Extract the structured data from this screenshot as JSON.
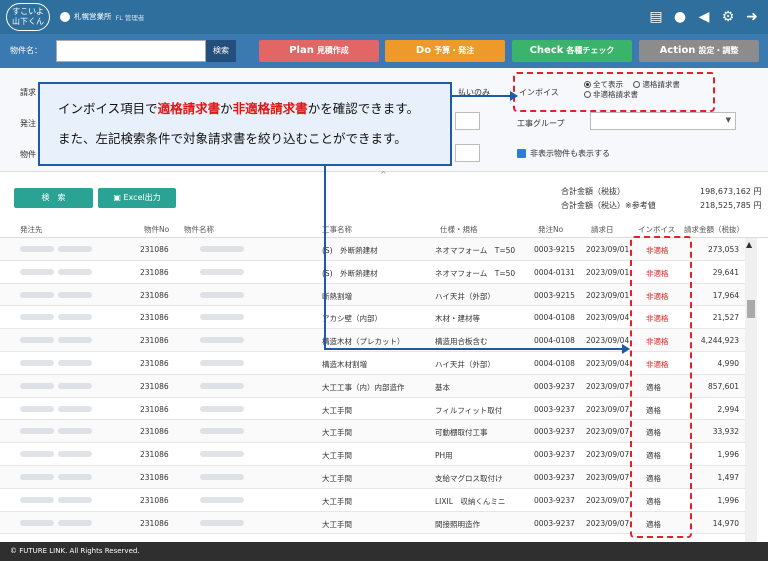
{
  "header": {
    "logo_line1": "すこいよ",
    "logo_line2": "山下くん",
    "office": "札幌営業所",
    "role": "FL 管理者",
    "icons": [
      "document-icon",
      "chat-icon",
      "megaphone-icon",
      "gear-icon",
      "logout-icon"
    ]
  },
  "searchbar": {
    "label": "物件名：",
    "value": "",
    "button": "検索"
  },
  "nav": [
    {
      "big": "Plan",
      "label": "見積作成",
      "color": "#e36666"
    },
    {
      "big": "Do",
      "label": "予算・発注",
      "color": "#ee9a2a"
    },
    {
      "big": "Check",
      "label": "各種チェック",
      "color": "#39b46a"
    },
    {
      "big": "Action",
      "label": "設定・調整",
      "color": "#8c8c8c"
    }
  ],
  "filters": {
    "label_request": "請求",
    "label_order": "発注",
    "label_property": "物件",
    "pay_only": "払いのみ",
    "invoice_label": "インボイス",
    "radio_all": "全て表示",
    "radio_qualified": "適格請求書",
    "radio_unqualified": "非適格請求書",
    "construction_group": "工事グループ",
    "show_hidden": "非表示物件も表示する"
  },
  "actions": {
    "search": "検　索",
    "excel": "Excel出力"
  },
  "totals": {
    "label_ex_tax": "合計金額（税抜）",
    "value_ex_tax": "198,673,162 円",
    "label_in_tax": "合計金額（税込）※参考値",
    "value_in_tax": "218,525,785 円"
  },
  "table": {
    "headers": [
      "発注先",
      "物件No",
      "物件名称",
      "工事名称",
      "仕様・規格",
      "発注No",
      "請求日",
      "インボイス",
      "請求金額（税抜）"
    ],
    "rows": [
      {
        "no": "231086",
        "work": "(S)　外断熱建材",
        "spec": "ネオマフォーム　T=50",
        "order": "0003-9215",
        "date": "2023/09/01",
        "invoice": "非適格",
        "amount": "273,053"
      },
      {
        "no": "231086",
        "work": "(S)　外断熱建材",
        "spec": "ネオマフォーム　T=50",
        "order": "0004-0131",
        "date": "2023/09/01",
        "invoice": "非適格",
        "amount": "29,641"
      },
      {
        "no": "231086",
        "work": "断熱割増",
        "spec": "ハイ天井（外部）",
        "order": "0003-9215",
        "date": "2023/09/01",
        "invoice": "非適格",
        "amount": "17,964"
      },
      {
        "no": "231086",
        "work": "アカシ壁（内部）",
        "spec": "木材・建材等",
        "order": "0004-0108",
        "date": "2023/09/04",
        "invoice": "非適格",
        "amount": "21,527"
      },
      {
        "no": "231086",
        "work": "構造木材（プレカット）",
        "spec": "構造用合板含む",
        "order": "0004-0108",
        "date": "2023/09/04",
        "invoice": "非適格",
        "amount": "4,244,923"
      },
      {
        "no": "231086",
        "work": "構造木材割増",
        "spec": "ハイ天井（外部）",
        "order": "0004-0108",
        "date": "2023/09/04",
        "invoice": "非適格",
        "amount": "4,990"
      },
      {
        "no": "231086",
        "work": "大工工事（内）内部造作",
        "spec": "基本",
        "order": "0003-9237",
        "date": "2023/09/07",
        "invoice": "適格",
        "amount": "857,601"
      },
      {
        "no": "231086",
        "work": "大工手間",
        "spec": "フィルフィット取付",
        "order": "0003-9237",
        "date": "2023/09/07",
        "invoice": "適格",
        "amount": "2,994"
      },
      {
        "no": "231086",
        "work": "大工手間",
        "spec": "可動棚取付工事",
        "order": "0003-9237",
        "date": "2023/09/07",
        "invoice": "適格",
        "amount": "33,932"
      },
      {
        "no": "231086",
        "work": "大工手間",
        "spec": "PH用",
        "order": "0003-9237",
        "date": "2023/09/07",
        "invoice": "適格",
        "amount": "1,996"
      },
      {
        "no": "231086",
        "work": "大工手間",
        "spec": "支給マグロス取付け",
        "order": "0003-9237",
        "date": "2023/09/07",
        "invoice": "適格",
        "amount": "1,497"
      },
      {
        "no": "231086",
        "work": "大工手間",
        "spec": "LIXIL　収納くんミニ",
        "order": "0003-9237",
        "date": "2023/09/07",
        "invoice": "適格",
        "amount": "1,996"
      },
      {
        "no": "231086",
        "work": "大工手間",
        "spec": "間接照明造作",
        "order": "0003-9237",
        "date": "2023/09/07",
        "invoice": "適格",
        "amount": "14,970"
      }
    ]
  },
  "callout": {
    "l1_a": "インボイス項目で",
    "l1_b": "適格請求書",
    "l1_c": "か",
    "l1_d": "非適格請求書",
    "l1_e": "かを確認できます。",
    "l2": "また、左記検索条件で対象請求書を絞り込むことができます。"
  },
  "footer": "© FUTURE LINK. All Rights Reserved."
}
